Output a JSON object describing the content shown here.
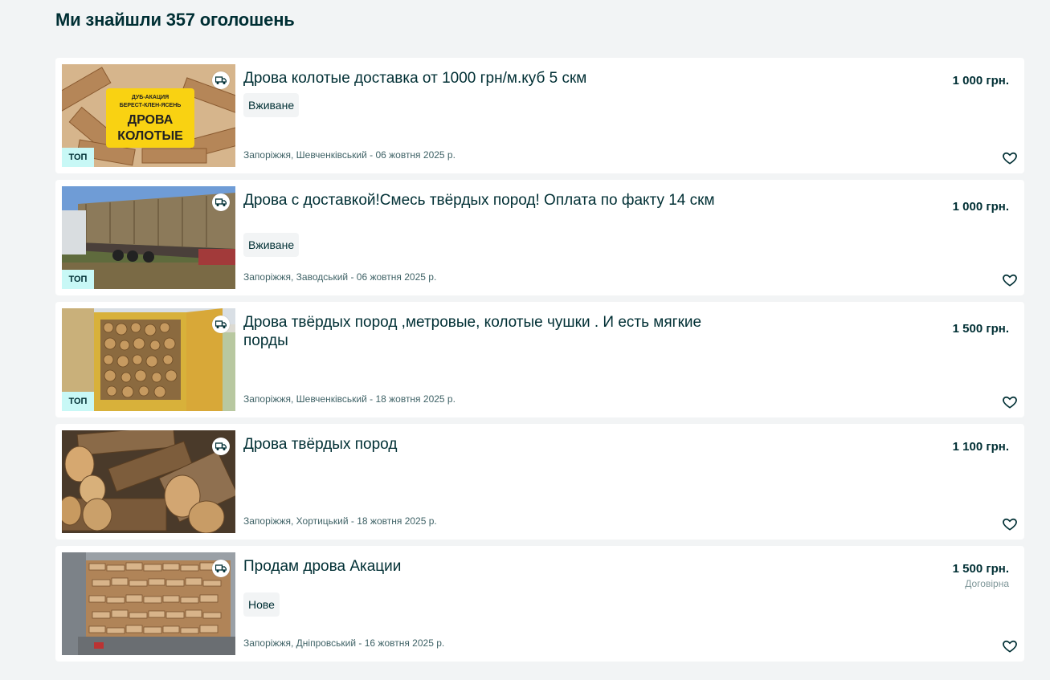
{
  "heading": "Ми знайшли 357 оголошень",
  "listings": [
    {
      "title": "Дрова колотые доставка от 1000 грн/м.куб 5 скм",
      "condition": "Вживане",
      "location": "Запоріжжя, Шевченківський - 06 жовтня 2025 р.",
      "price": "1 000 грн.",
      "top_badge": "ТОП",
      "image_text": [
        "ДУБ-АКАЦИЯ",
        "БЕРЕСТ-КЛЕН-ЯСЕНЬ",
        "ДРОВА",
        "КОЛОТЫЕ"
      ]
    },
    {
      "title": "Дрова с доставкой!Смесь твёрдых пород! Оплата по факту 14 скм",
      "condition": "Вживане",
      "location": "Запоріжжя, Заводський - 06 жовтня 2025 р.",
      "price": "1 000 грн.",
      "top_badge": "ТОП"
    },
    {
      "title": "Дрова твёрдых пород ,метровые, колотые чушки . И есть мягкие порды",
      "location": "Запоріжжя, Шевченківський - 18 жовтня 2025 р.",
      "price": "1 500 грн.",
      "top_badge": "ТОП"
    },
    {
      "title": "Дрова твёрдых пород",
      "location": "Запоріжжя, Хортицький - 18 жовтня 2025 р.",
      "price": "1 100 грн."
    },
    {
      "title": "Продам дрова Акации",
      "condition": "Нове",
      "location": "Запоріжжя, Дніпровський - 16 жовтня 2025 р.",
      "price": "1 500 грн.",
      "negotiable": "Договірна"
    }
  ],
  "icons": {
    "delivery": "truck-icon",
    "favorite": "heart-icon"
  },
  "colors": {
    "text": "#002f34",
    "background": "#f2f4f5",
    "top_badge": "#c8f8f6",
    "muted": "#406367"
  }
}
